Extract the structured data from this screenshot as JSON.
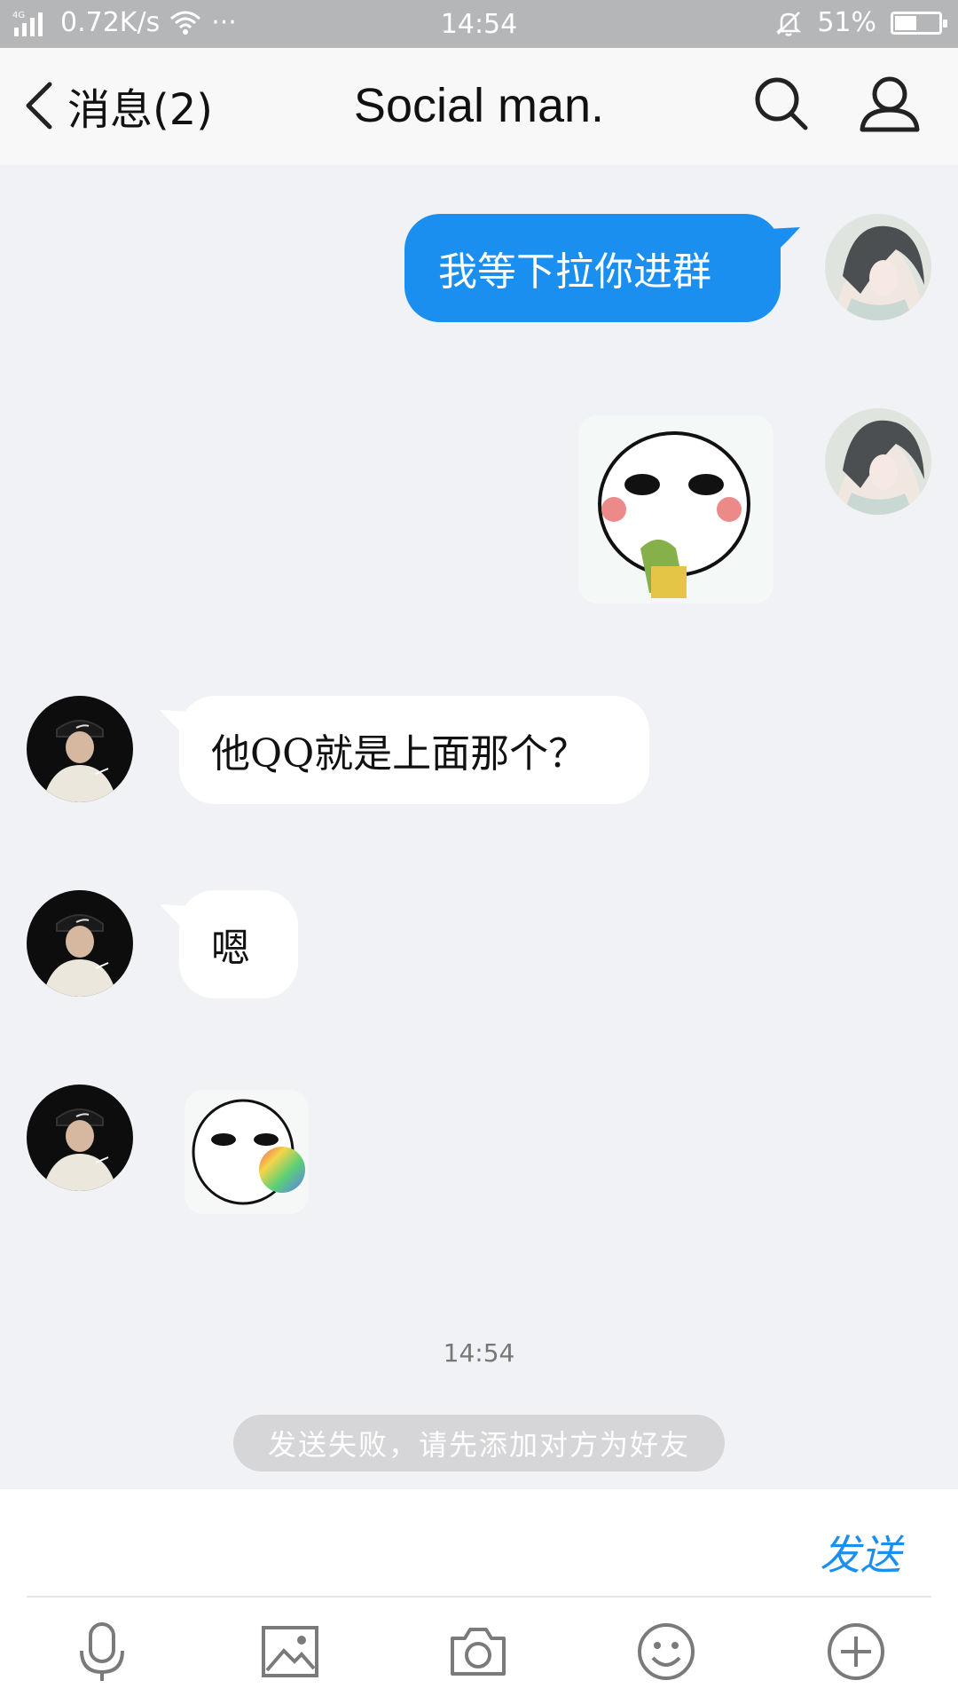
{
  "status_bar": {
    "network": "4G",
    "speed": "0.72K/s",
    "more": "···",
    "time": "14:54",
    "battery": "51%",
    "battery_level": 0.51
  },
  "nav": {
    "back_label": "消息(2)",
    "title": "Social man."
  },
  "messages": [
    {
      "side": "out",
      "type": "text",
      "text": "我等下拉你进群"
    },
    {
      "side": "out",
      "type": "sticker",
      "sticker": "drinking-face-sticker"
    },
    {
      "side": "in",
      "type": "text",
      "text": "他QQ就是上面那个？"
    },
    {
      "side": "in",
      "type": "text",
      "text": "嗯"
    },
    {
      "side": "in",
      "type": "sticker",
      "sticker": "rainbow-face-sticker"
    }
  ],
  "timestamp": "14:54",
  "fail_notice": "发送失败，请先添加对方为好友",
  "input": {
    "send_label": "发送"
  },
  "toolbar": [
    "microphone-icon",
    "image-icon",
    "camera-icon",
    "emoji-icon",
    "plus-icon"
  ],
  "colors": {
    "accent": "#1a8ff0",
    "background": "#f1f2f5",
    "status_bar": "#b5b6b8"
  }
}
